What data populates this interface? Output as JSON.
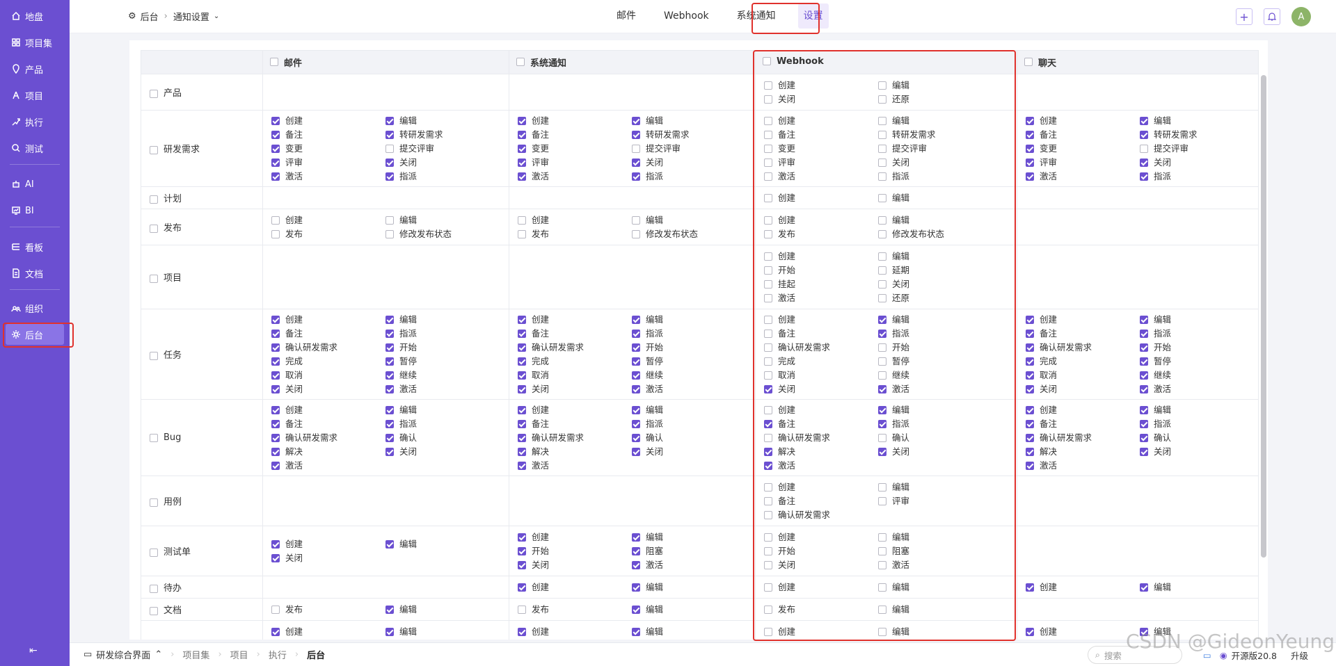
{
  "sidebar": {
    "items": [
      {
        "label": "地盘",
        "icon": "home-icon"
      },
      {
        "label": "项目集",
        "icon": "grid-icon"
      },
      {
        "label": "产品",
        "icon": "location-pin-icon"
      },
      {
        "label": "项目",
        "icon": "person-icon"
      },
      {
        "label": "执行",
        "icon": "run-icon"
      },
      {
        "label": "测试",
        "icon": "search-icon"
      },
      {
        "label": "AI",
        "icon": "robot-icon"
      },
      {
        "label": "BI",
        "icon": "bi-chart-icon"
      },
      {
        "label": "看板",
        "icon": "kanban-icon"
      },
      {
        "label": "文档",
        "icon": "document-icon"
      },
      {
        "label": "组织",
        "icon": "users-icon"
      },
      {
        "label": "后台",
        "icon": "gear-icon"
      }
    ],
    "active": "后台",
    "collapse_icon": "collapse-left-icon"
  },
  "header": {
    "breadcrumb": {
      "root": "后台",
      "current": "通知设置"
    },
    "tabs": [
      "邮件",
      "Webhook",
      "系统通知",
      "设置"
    ],
    "active_tab": "设置",
    "avatar": "A"
  },
  "table": {
    "columns": [
      "邮件",
      "系统通知",
      "Webhook",
      "聊天"
    ],
    "rows": [
      {
        "module": "产品",
        "cells": [
          [],
          [],
          [
            [
              "创建",
              false
            ],
            [
              "编辑",
              false
            ],
            [
              "关闭",
              false
            ],
            [
              "还原",
              false
            ]
          ],
          []
        ]
      },
      {
        "module": "研发需求",
        "cells": [
          [
            [
              "创建",
              true
            ],
            [
              "编辑",
              true
            ],
            [
              "备注",
              true
            ],
            [
              "转研发需求",
              true
            ],
            [
              "变更",
              true
            ],
            [
              "提交评审",
              false
            ],
            [
              "评审",
              true
            ],
            [
              "关闭",
              true
            ],
            [
              "激活",
              true
            ],
            [
              "指派",
              true
            ]
          ],
          [
            [
              "创建",
              true
            ],
            [
              "编辑",
              true
            ],
            [
              "备注",
              true
            ],
            [
              "转研发需求",
              true
            ],
            [
              "变更",
              true
            ],
            [
              "提交评审",
              false
            ],
            [
              "评审",
              true
            ],
            [
              "关闭",
              true
            ],
            [
              "激活",
              true
            ],
            [
              "指派",
              true
            ]
          ],
          [
            [
              "创建",
              false
            ],
            [
              "编辑",
              false
            ],
            [
              "备注",
              false
            ],
            [
              "转研发需求",
              false
            ],
            [
              "变更",
              false
            ],
            [
              "提交评审",
              false
            ],
            [
              "评审",
              false
            ],
            [
              "关闭",
              false
            ],
            [
              "激活",
              false
            ],
            [
              "指派",
              false
            ]
          ],
          [
            [
              "创建",
              true
            ],
            [
              "编辑",
              true
            ],
            [
              "备注",
              true
            ],
            [
              "转研发需求",
              true
            ],
            [
              "变更",
              true
            ],
            [
              "提交评审",
              false
            ],
            [
              "评审",
              true
            ],
            [
              "关闭",
              true
            ],
            [
              "激活",
              true
            ],
            [
              "指派",
              true
            ]
          ]
        ]
      },
      {
        "module": "计划",
        "cells": [
          [],
          [],
          [
            [
              "创建",
              false
            ],
            [
              "编辑",
              false
            ]
          ],
          []
        ]
      },
      {
        "module": "发布",
        "cells": [
          [
            [
              "创建",
              false
            ],
            [
              "编辑",
              false
            ],
            [
              "发布",
              false
            ],
            [
              "修改发布状态",
              false
            ]
          ],
          [
            [
              "创建",
              false
            ],
            [
              "编辑",
              false
            ],
            [
              "发布",
              false
            ],
            [
              "修改发布状态",
              false
            ]
          ],
          [
            [
              "创建",
              false
            ],
            [
              "编辑",
              false
            ],
            [
              "发布",
              false
            ],
            [
              "修改发布状态",
              false
            ]
          ],
          []
        ]
      },
      {
        "module": "项目",
        "cells": [
          [],
          [],
          [
            [
              "创建",
              false
            ],
            [
              "编辑",
              false
            ],
            [
              "开始",
              false
            ],
            [
              "延期",
              false
            ],
            [
              "挂起",
              false
            ],
            [
              "关闭",
              false
            ],
            [
              "激活",
              false
            ],
            [
              "还原",
              false
            ]
          ],
          []
        ]
      },
      {
        "module": "任务",
        "cells": [
          [
            [
              "创建",
              true
            ],
            [
              "编辑",
              true
            ],
            [
              "备注",
              true
            ],
            [
              "指派",
              true
            ],
            [
              "确认研发需求",
              true
            ],
            [
              "开始",
              true
            ],
            [
              "完成",
              true
            ],
            [
              "暂停",
              true
            ],
            [
              "取消",
              true
            ],
            [
              "继续",
              true
            ],
            [
              "关闭",
              true
            ],
            [
              "激活",
              true
            ]
          ],
          [
            [
              "创建",
              true
            ],
            [
              "编辑",
              true
            ],
            [
              "备注",
              true
            ],
            [
              "指派",
              true
            ],
            [
              "确认研发需求",
              true
            ],
            [
              "开始",
              true
            ],
            [
              "完成",
              true
            ],
            [
              "暂停",
              true
            ],
            [
              "取消",
              true
            ],
            [
              "继续",
              true
            ],
            [
              "关闭",
              true
            ],
            [
              "激活",
              true
            ]
          ],
          [
            [
              "创建",
              false
            ],
            [
              "编辑",
              true
            ],
            [
              "备注",
              false
            ],
            [
              "指派",
              true
            ],
            [
              "确认研发需求",
              false
            ],
            [
              "开始",
              false
            ],
            [
              "完成",
              false
            ],
            [
              "暂停",
              false
            ],
            [
              "取消",
              false
            ],
            [
              "继续",
              false
            ],
            [
              "关闭",
              true
            ],
            [
              "激活",
              true
            ]
          ],
          [
            [
              "创建",
              true
            ],
            [
              "编辑",
              true
            ],
            [
              "备注",
              true
            ],
            [
              "指派",
              true
            ],
            [
              "确认研发需求",
              true
            ],
            [
              "开始",
              true
            ],
            [
              "完成",
              true
            ],
            [
              "暂停",
              true
            ],
            [
              "取消",
              true
            ],
            [
              "继续",
              true
            ],
            [
              "关闭",
              true
            ],
            [
              "激活",
              true
            ]
          ]
        ]
      },
      {
        "module": "Bug",
        "cells": [
          [
            [
              "创建",
              true
            ],
            [
              "编辑",
              true
            ],
            [
              "备注",
              true
            ],
            [
              "指派",
              true
            ],
            [
              "确认研发需求",
              true
            ],
            [
              "确认",
              true
            ],
            [
              "解决",
              true
            ],
            [
              "关闭",
              true
            ],
            [
              "激活",
              true
            ]
          ],
          [
            [
              "创建",
              true
            ],
            [
              "编辑",
              true
            ],
            [
              "备注",
              true
            ],
            [
              "指派",
              true
            ],
            [
              "确认研发需求",
              true
            ],
            [
              "确认",
              true
            ],
            [
              "解决",
              true
            ],
            [
              "关闭",
              true
            ],
            [
              "激活",
              true
            ]
          ],
          [
            [
              "创建",
              false
            ],
            [
              "编辑",
              true
            ],
            [
              "备注",
              true
            ],
            [
              "指派",
              true
            ],
            [
              "确认研发需求",
              false
            ],
            [
              "确认",
              false
            ],
            [
              "解决",
              true
            ],
            [
              "关闭",
              true
            ],
            [
              "激活",
              true
            ]
          ],
          [
            [
              "创建",
              true
            ],
            [
              "编辑",
              true
            ],
            [
              "备注",
              true
            ],
            [
              "指派",
              true
            ],
            [
              "确认研发需求",
              true
            ],
            [
              "确认",
              true
            ],
            [
              "解决",
              true
            ],
            [
              "关闭",
              true
            ],
            [
              "激活",
              true
            ]
          ]
        ]
      },
      {
        "module": "用例",
        "cells": [
          [],
          [],
          [
            [
              "创建",
              false
            ],
            [
              "编辑",
              false
            ],
            [
              "备注",
              false
            ],
            [
              "评审",
              false
            ],
            [
              "确认研发需求",
              false
            ]
          ],
          []
        ]
      },
      {
        "module": "测试单",
        "cells": [
          [
            [
              "创建",
              true
            ],
            [
              "编辑",
              true
            ],
            [
              "关闭",
              true
            ]
          ],
          [
            [
              "创建",
              true
            ],
            [
              "编辑",
              true
            ],
            [
              "开始",
              true
            ],
            [
              "阻塞",
              true
            ],
            [
              "关闭",
              true
            ],
            [
              "激活",
              true
            ]
          ],
          [
            [
              "创建",
              false
            ],
            [
              "编辑",
              false
            ],
            [
              "开始",
              false
            ],
            [
              "阻塞",
              false
            ],
            [
              "关闭",
              false
            ],
            [
              "激活",
              false
            ]
          ],
          []
        ]
      },
      {
        "module": "待办",
        "cells": [
          [],
          [
            [
              "创建",
              true
            ],
            [
              "编辑",
              true
            ]
          ],
          [
            [
              "创建",
              false
            ],
            [
              "编辑",
              false
            ]
          ],
          [
            [
              "创建",
              true
            ],
            [
              "编辑",
              true
            ]
          ]
        ]
      },
      {
        "module": "文档",
        "cells": [
          [
            [
              "发布",
              false
            ],
            [
              "编辑",
              true
            ]
          ],
          [
            [
              "发布",
              false
            ],
            [
              "编辑",
              true
            ]
          ],
          [
            [
              "发布",
              false
            ],
            [
              "编辑",
              false
            ]
          ],
          []
        ]
      },
      {
        "module": "",
        "cells": [
          [
            [
              "创建",
              true
            ],
            [
              "编辑",
              true
            ]
          ],
          [
            [
              "创建",
              true
            ],
            [
              "编辑",
              true
            ]
          ],
          [
            [
              "创建",
              false
            ],
            [
              "编辑",
              false
            ]
          ],
          [
            [
              "创建",
              true
            ],
            [
              "编辑",
              true
            ]
          ]
        ]
      }
    ]
  },
  "bottom": {
    "crumbs": [
      "研发综合界面",
      "项目集",
      "项目",
      "执行",
      "后台"
    ],
    "search_placeholder": "搜索",
    "version": "开源版20.8",
    "upgrade": "升级"
  },
  "watermark": "CSDN @GideonYeung",
  "colors": {
    "sidebar": "#6b4fd1",
    "accent": "#6b4fd1",
    "highlight": "#e0312c"
  }
}
